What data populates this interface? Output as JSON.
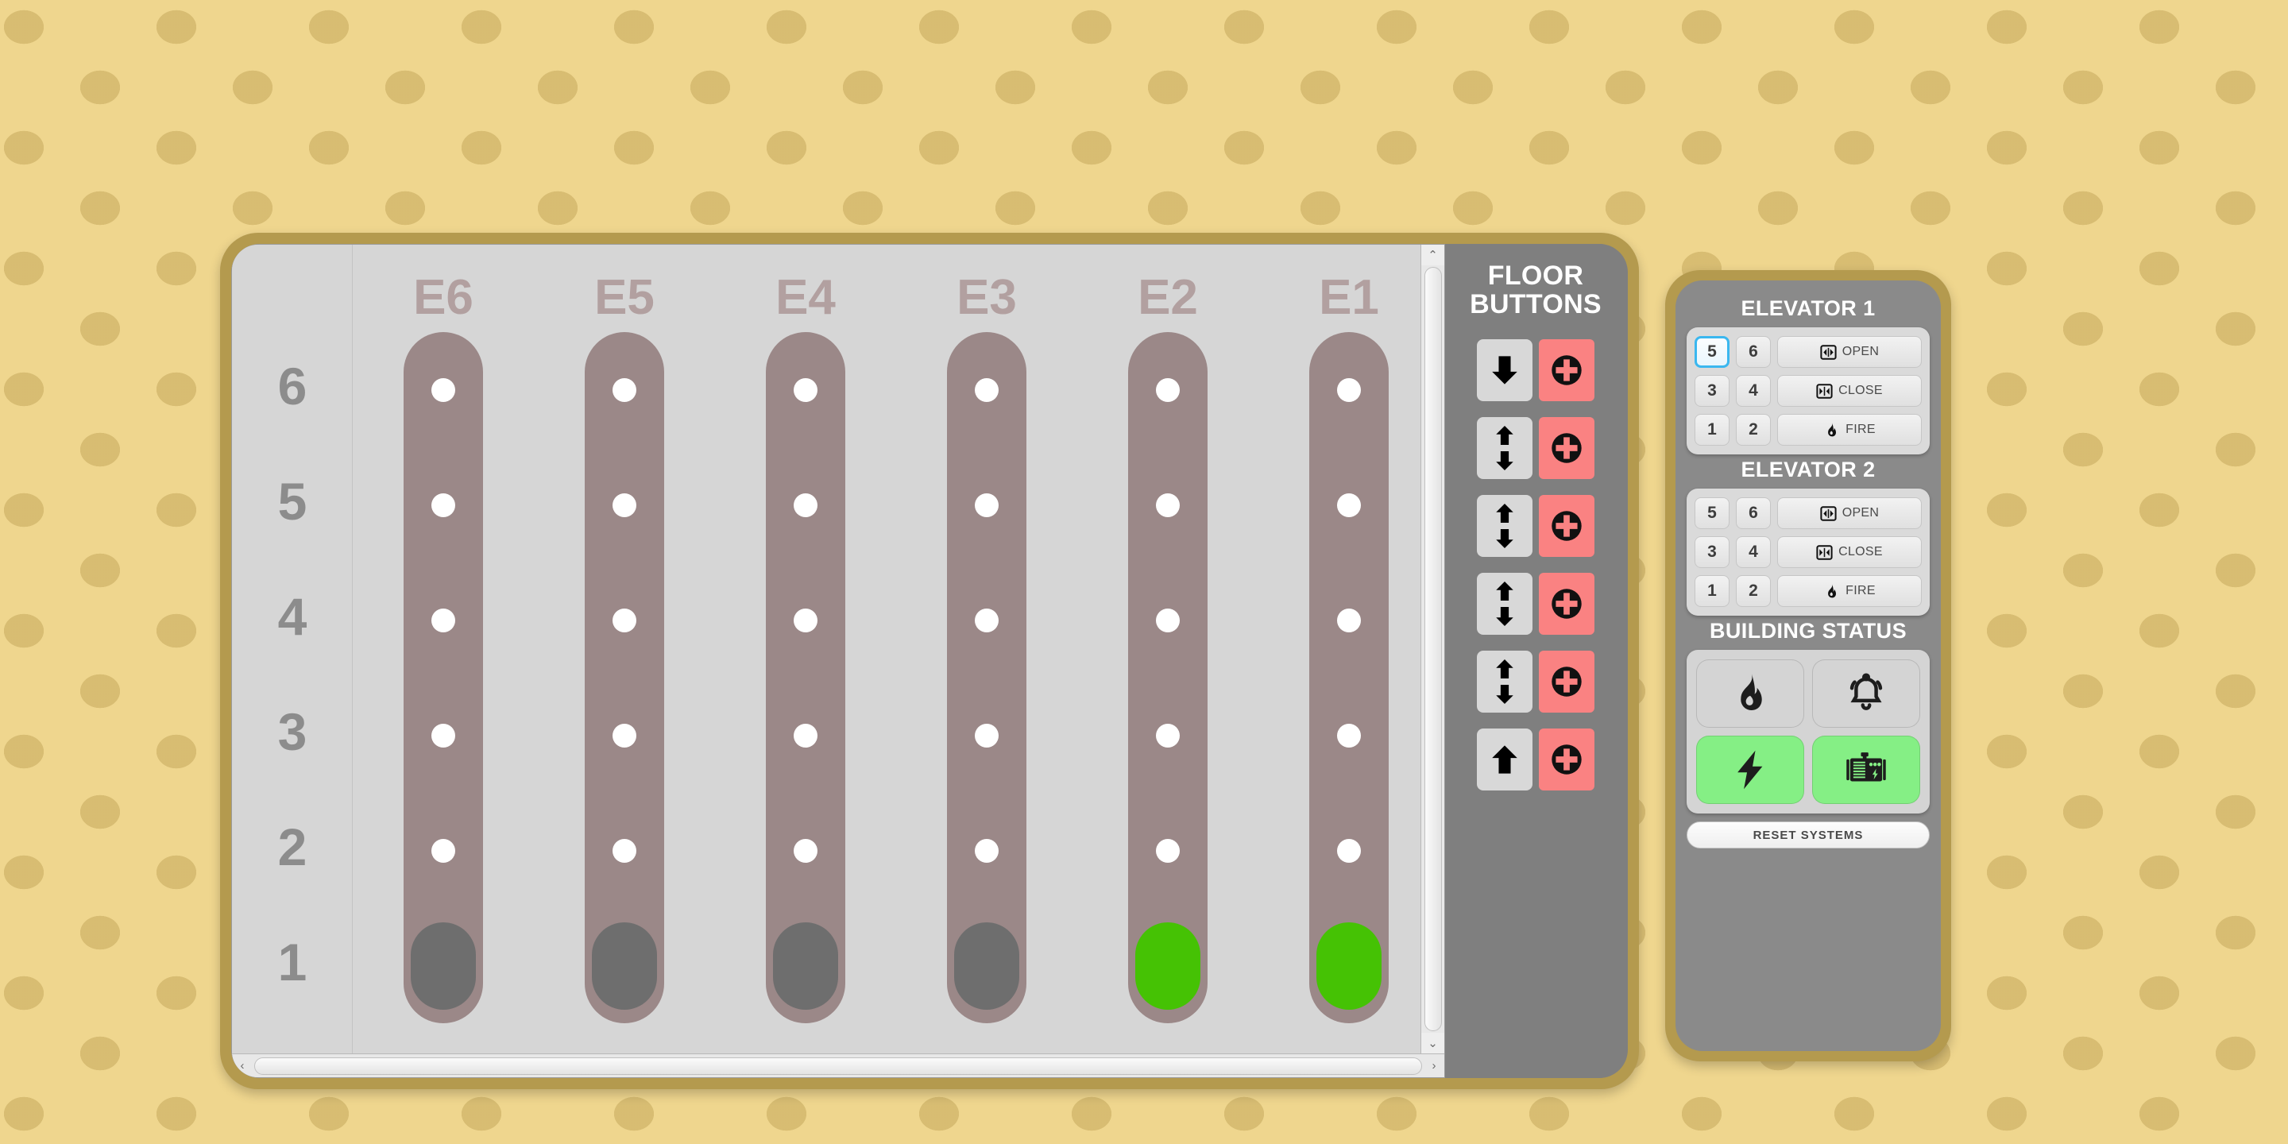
{
  "background": {
    "base_color": "#efd68e",
    "dot_color": "#c4a75c"
  },
  "shaft_panel": {
    "frame_color": "#b49a4e",
    "floor_labels": [
      "6",
      "5",
      "4",
      "3",
      "2",
      "1"
    ],
    "elevators": [
      {
        "name": "E6",
        "car_floor": 1,
        "car_state": "idle"
      },
      {
        "name": "E5",
        "car_floor": 1,
        "car_state": "idle"
      },
      {
        "name": "E4",
        "car_floor": 1,
        "car_state": "idle"
      },
      {
        "name": "E3",
        "car_floor": 1,
        "car_state": "idle"
      },
      {
        "name": "E2",
        "car_floor": 1,
        "car_state": "active"
      },
      {
        "name": "E1",
        "car_floor": 1,
        "car_state": "active"
      }
    ],
    "shaft_color": "#9b8888",
    "floor_dot_color": "#ffffff",
    "car_idle_color": "#6e6e6e",
    "car_active_color": "#45c204",
    "scrollbar": {
      "up_arrow": "⌃",
      "down_arrow": "⌄",
      "left_arrow": "‹",
      "right_arrow": "›"
    }
  },
  "floor_buttons": {
    "title_line1": "FLOOR",
    "title_line2": "BUTTONS",
    "call_button_color": "#fa8282",
    "rows": [
      {
        "floor": "6",
        "up": false,
        "down": true,
        "call_icon": "emergency-call-icon"
      },
      {
        "floor": "5",
        "up": true,
        "down": true,
        "call_icon": "emergency-call-icon"
      },
      {
        "floor": "4",
        "up": true,
        "down": true,
        "call_icon": "emergency-call-icon"
      },
      {
        "floor": "3",
        "up": true,
        "down": true,
        "call_icon": "emergency-call-icon"
      },
      {
        "floor": "2",
        "up": true,
        "down": true,
        "call_icon": "emergency-call-icon"
      },
      {
        "floor": "1",
        "up": true,
        "down": false,
        "call_icon": "emergency-call-icon"
      }
    ]
  },
  "control_panel": {
    "frame_color": "#b49a4e",
    "elevator1": {
      "title": "ELEVATOR 1",
      "numbers": [
        "5",
        "6",
        "3",
        "4",
        "1",
        "2"
      ],
      "selected_number": "5",
      "selected_outline_color": "#3ab7ef",
      "actions": [
        {
          "label": "OPEN",
          "icon": "doors-open-icon"
        },
        {
          "label": "CLOSE",
          "icon": "doors-close-icon"
        },
        {
          "label": "FIRE",
          "icon": "flame-icon"
        }
      ]
    },
    "elevator2": {
      "title": "ELEVATOR 2",
      "numbers": [
        "5",
        "6",
        "3",
        "4",
        "1",
        "2"
      ],
      "selected_number": null,
      "actions": [
        {
          "label": "OPEN",
          "icon": "doors-open-icon"
        },
        {
          "label": "CLOSE",
          "icon": "doors-close-icon"
        },
        {
          "label": "FIRE",
          "icon": "flame-icon"
        }
      ]
    },
    "building_status": {
      "title": "BUILDING STATUS",
      "on_color": "#85ef85",
      "off_color": "#d4d4d4",
      "tiles": [
        {
          "icon": "flame-icon",
          "state": "off"
        },
        {
          "icon": "alarm-bell-icon",
          "state": "off"
        },
        {
          "icon": "power-bolt-icon",
          "state": "on"
        },
        {
          "icon": "generator-icon",
          "state": "on"
        }
      ],
      "reset_label": "RESET SYSTEMS"
    }
  }
}
